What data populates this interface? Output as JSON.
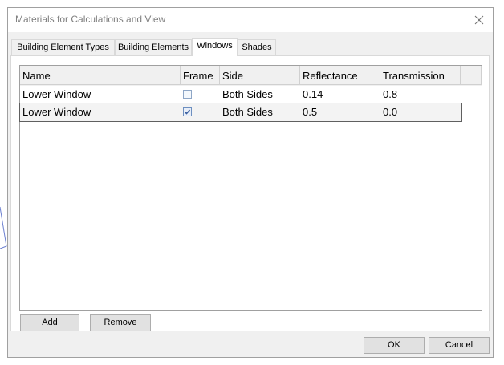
{
  "dialog": {
    "title": "Materials for Calculations and View"
  },
  "tabs": [
    {
      "label": "Building Element Types",
      "active": false
    },
    {
      "label": "Building Elements",
      "active": false
    },
    {
      "label": "Windows",
      "active": true
    },
    {
      "label": "Shades",
      "active": false
    }
  ],
  "grid": {
    "columns": [
      "Name",
      "Frame",
      "Side",
      "Reflectance",
      "Transmission"
    ],
    "rows": [
      {
        "name": "Lower Window",
        "frame": false,
        "side": "Both Sides",
        "reflectance": "0.14",
        "transmission": "0.8",
        "selected": false
      },
      {
        "name": "Lower Window",
        "frame": true,
        "side": "Both Sides",
        "reflectance": "0.5",
        "transmission": "0.0",
        "selected": true
      }
    ]
  },
  "buttons": {
    "add": "Add",
    "remove": "Remove",
    "ok": "OK",
    "cancel": "Cancel"
  },
  "colors": {
    "check": "#3a5fa0",
    "border": "#a0a0a0",
    "background": "#f0f0f0"
  },
  "icons": {
    "close": "close-icon",
    "check": "check-icon"
  }
}
